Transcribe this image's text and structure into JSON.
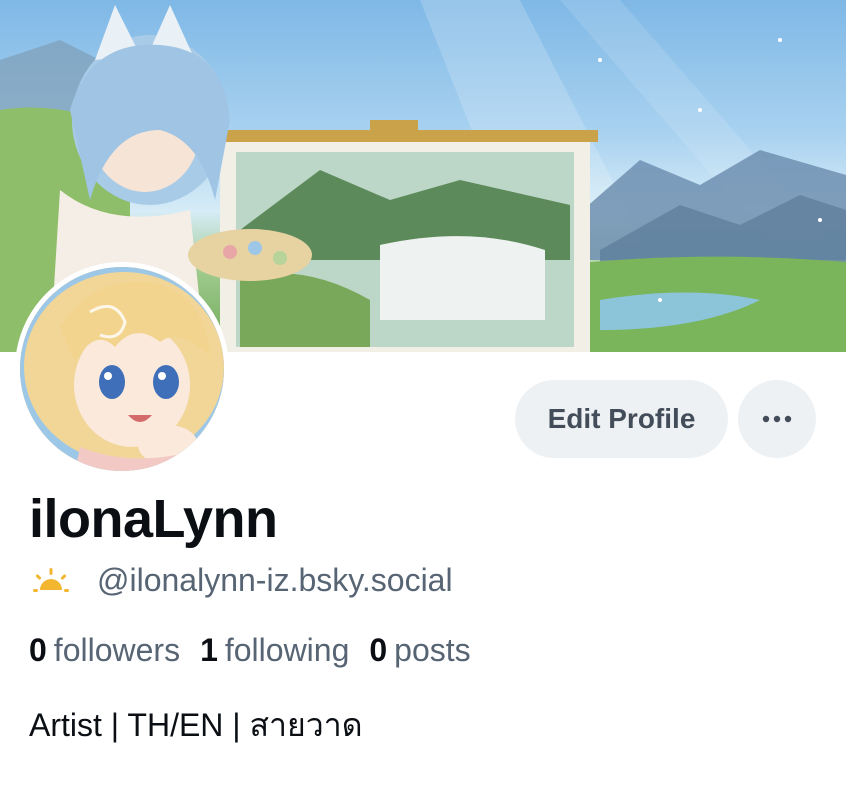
{
  "profile": {
    "display_name": "ilonaLynn",
    "handle": "@ilonalynn-iz.bsky.social",
    "bio": "Artist | TH/EN | สายวาด"
  },
  "actions": {
    "edit_label": "Edit Profile",
    "more_icon": "ellipsis-icon"
  },
  "stats": {
    "followers_count": "0",
    "followers_label": "followers",
    "following_count": "1",
    "following_label": "following",
    "posts_count": "0",
    "posts_label": "posts"
  },
  "icons": {
    "status_icon": "sunrise-icon"
  },
  "colors": {
    "primary_text": "#0b0f14",
    "secondary_text": "#566473",
    "button_bg": "#eef1f4",
    "button_text": "#434d59",
    "sun_icon": "#f2b631"
  }
}
